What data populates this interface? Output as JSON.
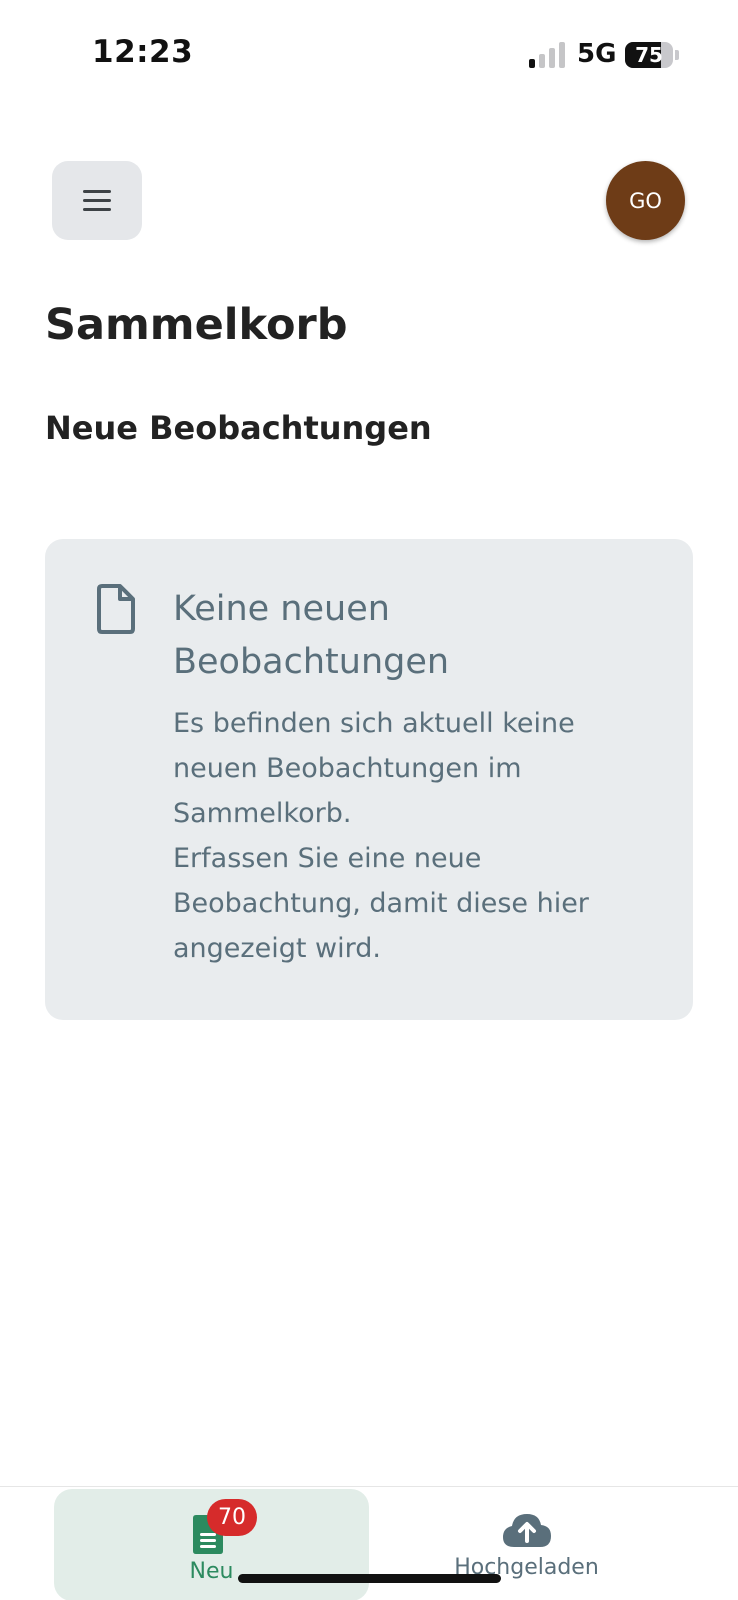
{
  "status_bar": {
    "time": "12:23",
    "network": "5G",
    "battery_level": "75",
    "signal_bars_active": 1,
    "signal_bars_total": 4
  },
  "header": {
    "menu_icon": "hamburger-menu-icon",
    "avatar_initials": "GO",
    "avatar_color": "#6e3c17"
  },
  "page": {
    "title": "Sammelkorb",
    "section_title": "Neue Beobachtungen"
  },
  "empty_state": {
    "icon": "document-icon",
    "heading": "Keine neuen Beobachtungen",
    "text_line1": "Es befinden sich aktuell keine neuen Beobachtungen im Sammelkorb.",
    "text_line2": "Erfassen Sie eine neue Beobachtung, damit diese hier angezeigt wird."
  },
  "bottom_nav": {
    "items": [
      {
        "label": "Neu",
        "icon": "document-list-icon",
        "badge": "70",
        "active": true
      },
      {
        "label": "Hochgeladen",
        "icon": "cloud-upload-icon",
        "active": false
      }
    ]
  },
  "colors": {
    "accent_green": "#2c8a5f",
    "badge_red": "#d62b2b",
    "muted_text": "#5a6f7b",
    "card_background": "#e9ecee"
  }
}
